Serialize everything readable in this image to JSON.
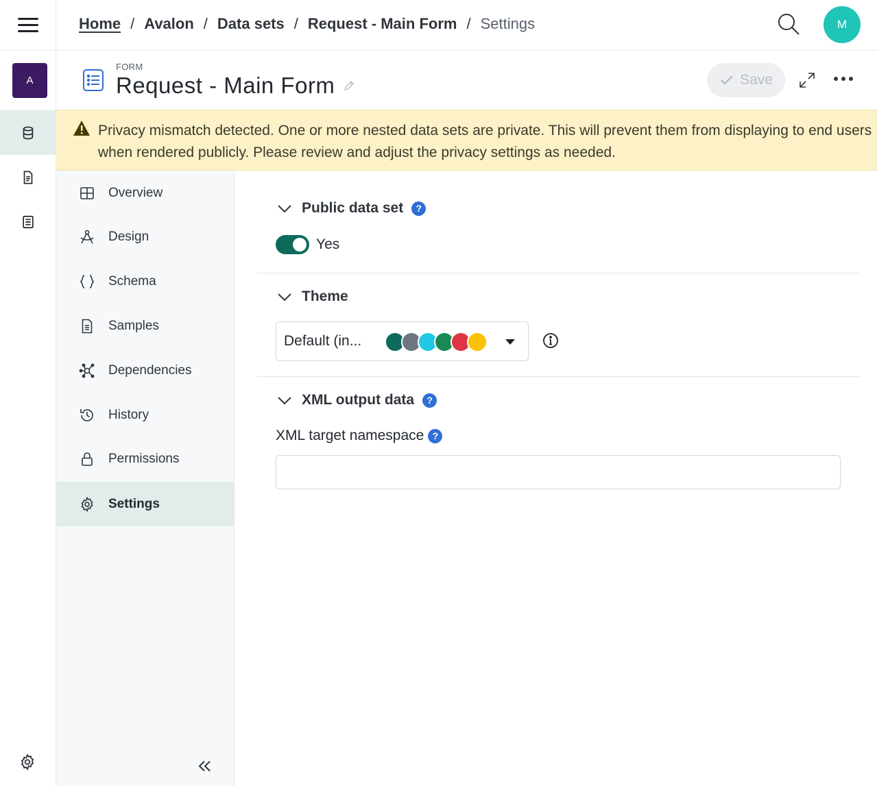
{
  "rail": {
    "app_initial": "A",
    "items": [
      {
        "name": "data-sets",
        "active": true
      },
      {
        "name": "documents",
        "active": false
      },
      {
        "name": "forms",
        "active": false
      }
    ]
  },
  "breadcrumb": {
    "items": [
      "Home",
      "Avalon",
      "Data sets",
      "Request - Main Form"
    ],
    "current": "Settings",
    "separator": "/"
  },
  "user": {
    "initial": "M"
  },
  "header": {
    "kind": "FORM",
    "title": "Request - Main Form",
    "save_label": "Save"
  },
  "banner": {
    "text": "Privacy mismatch detected. One or more nested data sets are private. This will prevent them from displaying to end users when rendered publicly. Please review and adjust the privacy settings as needed."
  },
  "nav": {
    "items": [
      {
        "label": "Overview",
        "icon": "table-icon"
      },
      {
        "label": "Design",
        "icon": "compass-icon"
      },
      {
        "label": "Schema",
        "icon": "braces-icon"
      },
      {
        "label": "Samples",
        "icon": "document-icon"
      },
      {
        "label": "Dependencies",
        "icon": "network-icon"
      },
      {
        "label": "History",
        "icon": "history-icon"
      },
      {
        "label": "Permissions",
        "icon": "lock-icon"
      },
      {
        "label": "Settings",
        "icon": "gear-icon"
      }
    ],
    "active": "Settings"
  },
  "settings": {
    "public": {
      "title": "Public data set",
      "help": "?",
      "toggle_on": true,
      "toggle_label": "Yes"
    },
    "theme": {
      "title": "Theme",
      "selected": "Default (in...",
      "swatches": [
        "#0e6b5c",
        "#6e7781",
        "#1fc8e3",
        "#1a8a54",
        "#dc3545",
        "#fdc008"
      ]
    },
    "xml": {
      "title": "XML output data",
      "help": "?",
      "namespace_label": "XML target namespace",
      "namespace_value": "",
      "namespace_placeholder": ""
    }
  },
  "colors": {
    "accent": "#0e6b5c",
    "avatar": "#1fc5b6",
    "app": "#3b1a63",
    "help": "#2f6fd6",
    "banner": "#fdf1c7"
  }
}
